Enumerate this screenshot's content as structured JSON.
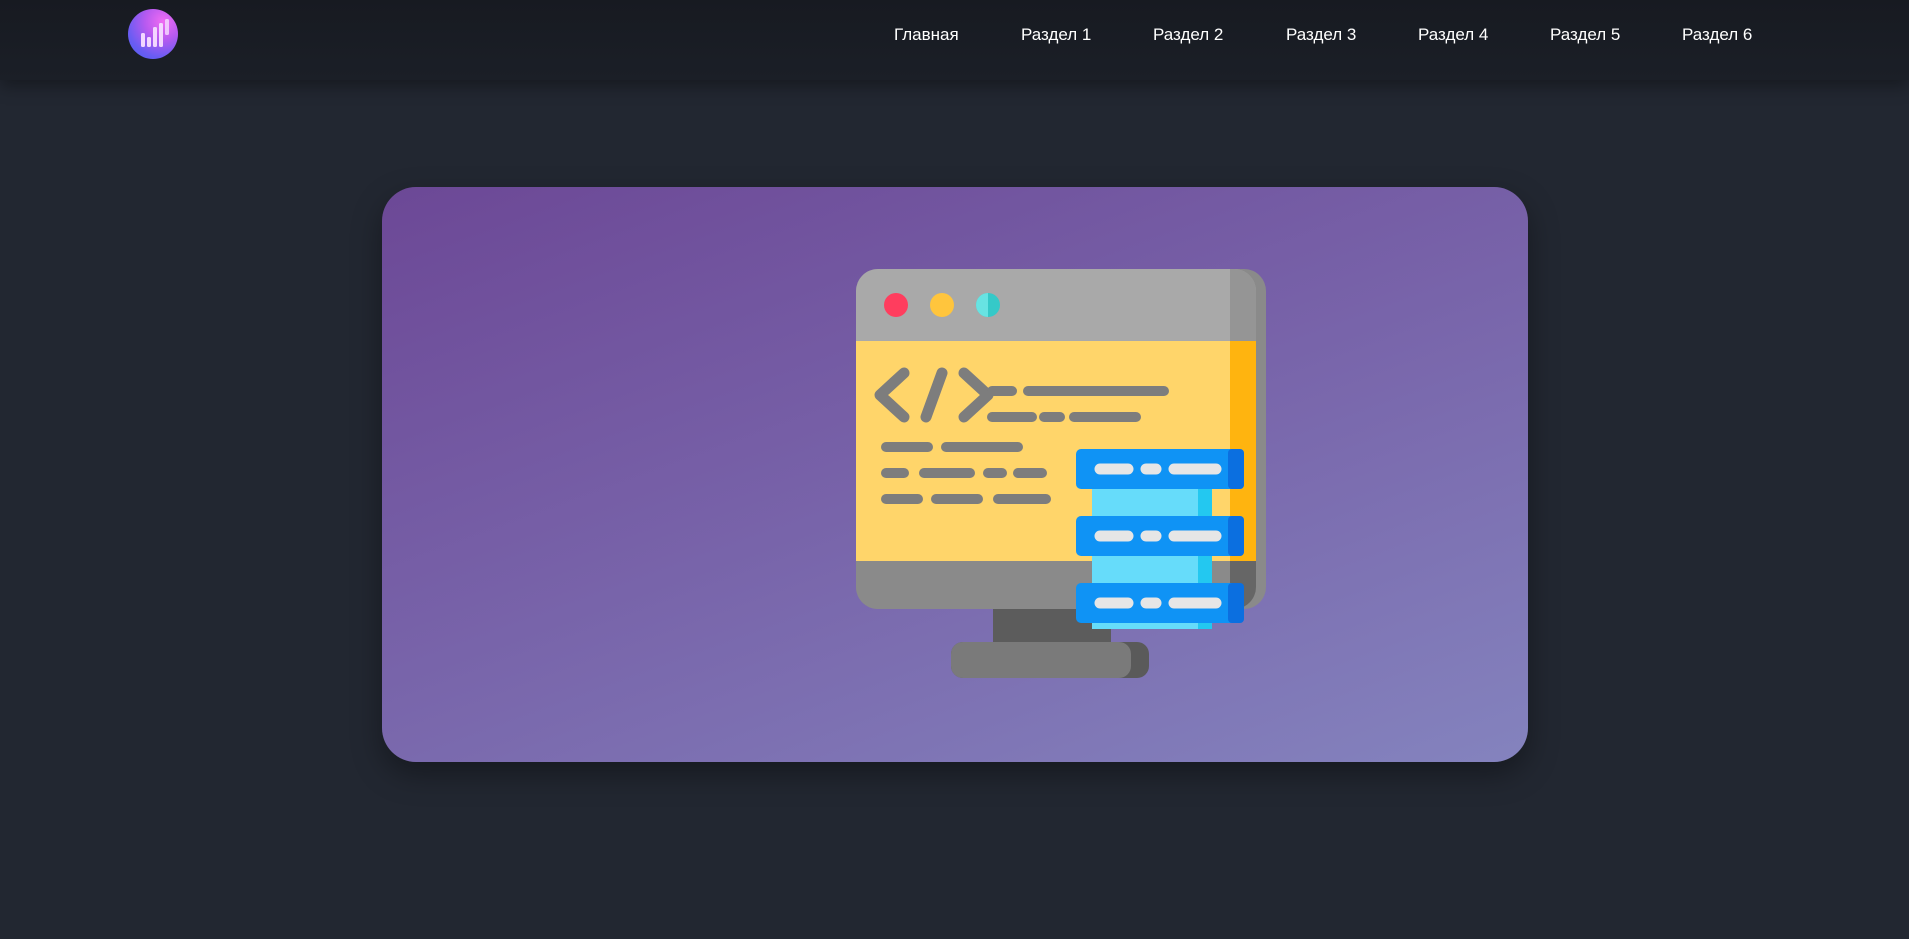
{
  "header": {
    "logo_icon": "bar-chart-logo-icon",
    "nav": [
      {
        "label": "Главная"
      },
      {
        "label": "Раздел 1"
      },
      {
        "label": "Раздел 2"
      },
      {
        "label": "Раздел 3"
      },
      {
        "label": "Раздел 4"
      },
      {
        "label": "Раздел 5"
      },
      {
        "label": "Раздел 6"
      }
    ]
  },
  "hero": {
    "illustration_icon": "code-monitor-server-icon",
    "colors": {
      "card_gradient_start": "#6c4896",
      "card_gradient_end": "#8483be",
      "page_background": "#222731",
      "header_background": "#171a21"
    }
  }
}
